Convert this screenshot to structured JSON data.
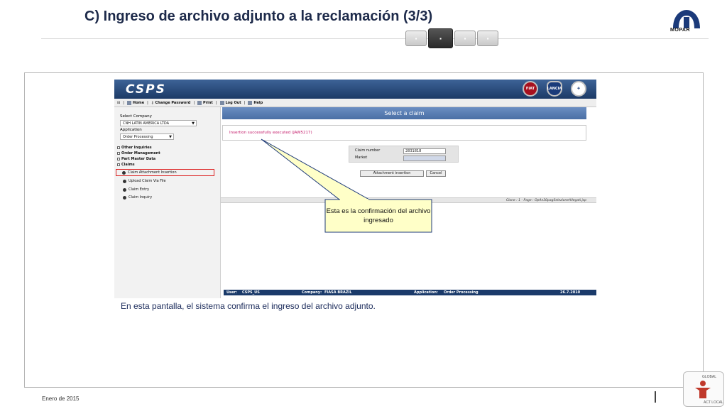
{
  "slide": {
    "title": "C) Ingreso de archivo adjunto a la reclamación (3/3)",
    "brand_logo_text": "MOPAR",
    "footer_date": "Enero de 2015",
    "badge_top": "GLOBAL",
    "badge_bottom": "ACT LOCAL",
    "caption": "En esta pantalla, el sistema confirma el ingreso del archivo adjunto.",
    "callout": "Esta es la confirmación del archivo ingresado",
    "step_nav": {
      "total": 4,
      "active_index": 1
    }
  },
  "app": {
    "logo": "CSPS",
    "brands": [
      "FIAT",
      "LANCIA",
      "ALFA ROMEO"
    ],
    "toolbar": {
      "home": "Home",
      "change_password": "Change Password",
      "print": "Print",
      "log_out": "Log Out",
      "help": "Help"
    },
    "sidebar": {
      "select_company_label": "Select Company",
      "company_value": "CNH LATIN AMERICA LTDA",
      "application_label": "Application",
      "application_value": "Order Processing",
      "menu": [
        "Other Inquiries",
        "Order Management",
        "Part Master Data",
        "Claims"
      ],
      "claims_items": [
        "Claim Attachment Insertion",
        "Upload Claim Via File",
        "Claim Entry",
        "Claim Inquiry"
      ],
      "active_item": "Claim Attachment Insertion"
    },
    "main": {
      "title": "Select a claim",
      "message": "Insertion successfully executed (JAW5217)",
      "claim_number_label": "Claim number",
      "claim_number_value": "2831818",
      "market_label": "Market",
      "attach_button": "Attachment insertion",
      "cancel_button": "Cancel",
      "footer_path": "Clone : 1 - Page : OpAn30pagSelezioneAllegati.jsp"
    },
    "status": {
      "user_label": "User:",
      "user_value": "CSPS_US",
      "company_label": "Company:",
      "company_value": "FIASA BRAZIL",
      "application_label": "Application:",
      "application_value": "Order Processing",
      "date": "26.7.2010"
    }
  },
  "colors": {
    "title": "#1d2a4a",
    "app_header": "#1c3a66",
    "message": "#c41c6b",
    "highlight_border": "#dd2222",
    "callout_fill": "#ffffc8",
    "callout_border": "#1f3b7a"
  }
}
